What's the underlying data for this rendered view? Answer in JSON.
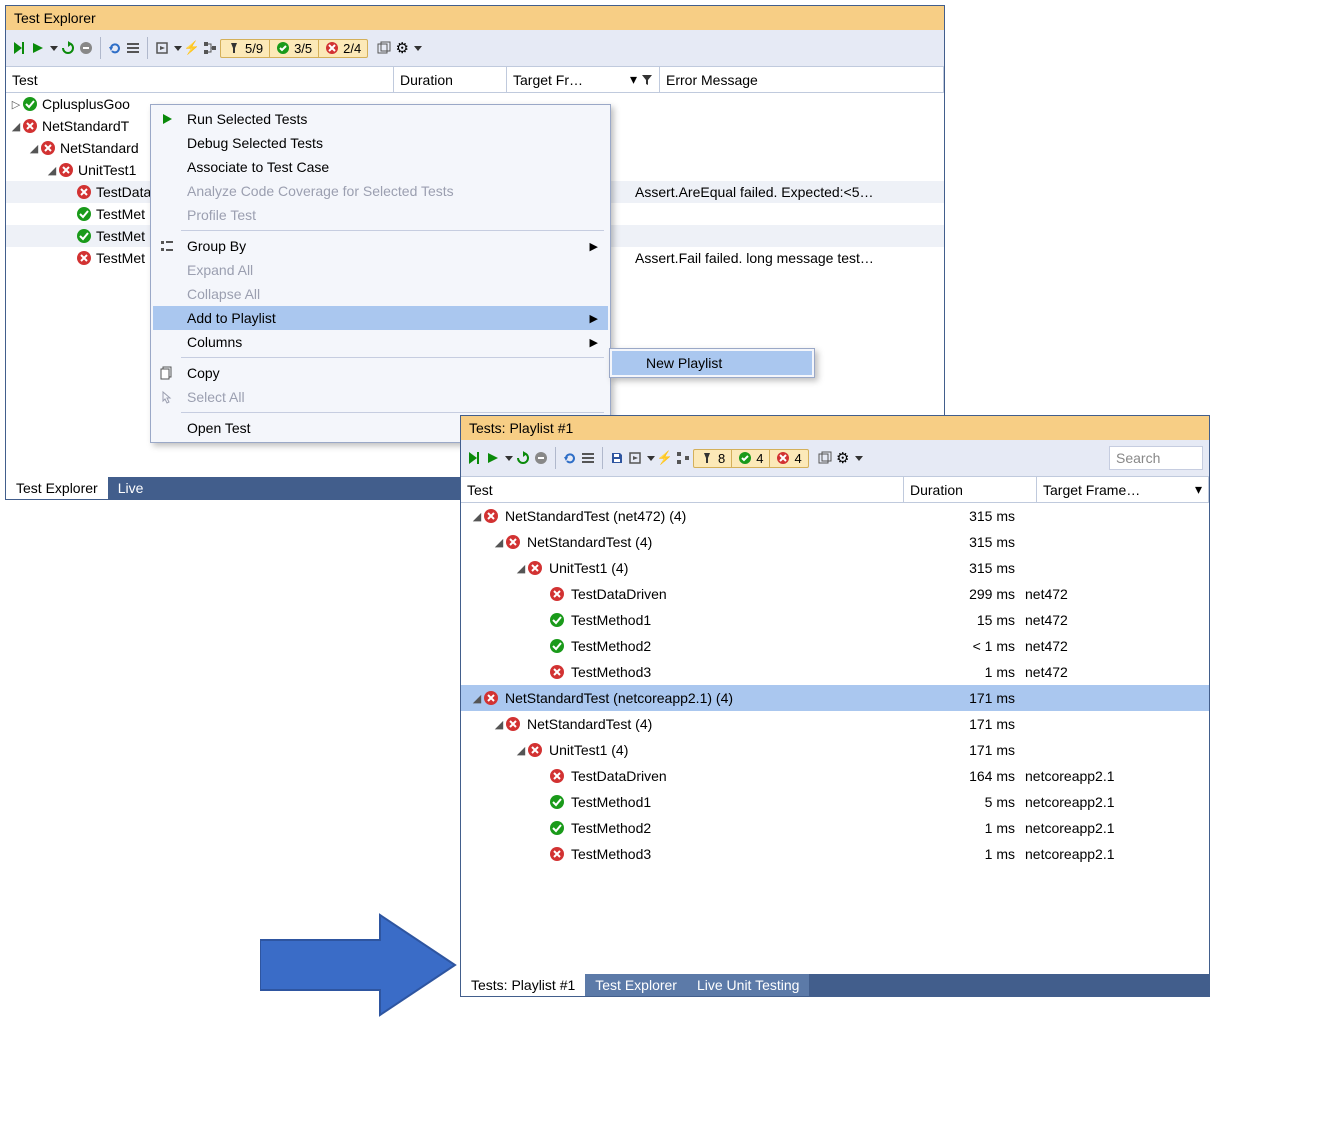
{
  "panel1": {
    "title": "Test Explorer",
    "counts": {
      "total": "5/9",
      "pass": "3/5",
      "fail": "2/4"
    },
    "columns": [
      "Test",
      "Duration",
      "Target Fr…",
      "Error Message"
    ],
    "tree": [
      {
        "indent": 0,
        "exp": "▷",
        "icon": "pass",
        "label": "CplusplusGoo"
      },
      {
        "indent": 0,
        "exp": "◢",
        "icon": "fail",
        "label": "NetStandardT"
      },
      {
        "indent": 1,
        "exp": "◢",
        "icon": "fail",
        "label": "NetStandard"
      },
      {
        "indent": 2,
        "exp": "◢",
        "icon": "fail",
        "label": "UnitTest1"
      },
      {
        "indent": 3,
        "exp": "",
        "icon": "fail",
        "label": "TestData",
        "err": "Assert.AreEqual failed. Expected:<5…",
        "alt": true
      },
      {
        "indent": 3,
        "exp": "",
        "icon": "pass",
        "label": "TestMet"
      },
      {
        "indent": 3,
        "exp": "",
        "icon": "pass",
        "label": "TestMet",
        "alt": true
      },
      {
        "indent": 3,
        "exp": "",
        "icon": "fail",
        "label": "TestMet",
        "err": "Assert.Fail failed. long message test…"
      }
    ],
    "tabs": [
      "Test Explorer",
      "Live"
    ]
  },
  "context_menu": {
    "items": [
      {
        "label": "Run Selected Tests",
        "enabled": true,
        "icon": "play"
      },
      {
        "label": "Debug Selected Tests",
        "enabled": true
      },
      {
        "label": "Associate to Test Case",
        "enabled": true
      },
      {
        "label": "Analyze Code Coverage for Selected Tests",
        "enabled": false
      },
      {
        "label": "Profile Test",
        "enabled": false
      },
      {
        "sep": true
      },
      {
        "label": "Group By",
        "enabled": true,
        "icon": "group",
        "arrow": true
      },
      {
        "label": "Expand All",
        "enabled": false
      },
      {
        "label": "Collapse All",
        "enabled": false
      },
      {
        "label": "Add to Playlist",
        "enabled": true,
        "arrow": true,
        "hover": true
      },
      {
        "label": "Columns",
        "enabled": true,
        "arrow": true
      },
      {
        "sep": true
      },
      {
        "label": "Copy",
        "enabled": true,
        "icon": "copy"
      },
      {
        "label": "Select All",
        "enabled": false,
        "icon": "pointer"
      },
      {
        "sep": true
      },
      {
        "label": "Open Test",
        "enabled": true
      }
    ],
    "submenu": {
      "label": "New Playlist"
    }
  },
  "panel2": {
    "title": "Tests: Playlist #1",
    "counts": {
      "total": "8",
      "pass": "4",
      "fail": "4"
    },
    "search_placeholder": "Search",
    "columns": [
      "Test",
      "Duration",
      "Target Frame…"
    ],
    "tree": [
      {
        "indent": 0,
        "exp": "◢",
        "icon": "fail",
        "label": "NetStandardTest (net472)  (4)",
        "dur": "315 ms"
      },
      {
        "indent": 1,
        "exp": "◢",
        "icon": "fail",
        "label": "NetStandardTest  (4)",
        "dur": "315 ms"
      },
      {
        "indent": 2,
        "exp": "◢",
        "icon": "fail",
        "label": "UnitTest1  (4)",
        "dur": "315 ms"
      },
      {
        "indent": 3,
        "exp": "",
        "icon": "fail",
        "label": "TestDataDriven",
        "dur": "299 ms",
        "tgt": "net472"
      },
      {
        "indent": 3,
        "exp": "",
        "icon": "pass",
        "label": "TestMethod1",
        "dur": "15 ms",
        "tgt": "net472"
      },
      {
        "indent": 3,
        "exp": "",
        "icon": "pass",
        "label": "TestMethod2",
        "dur": "< 1 ms",
        "tgt": "net472"
      },
      {
        "indent": 3,
        "exp": "",
        "icon": "fail",
        "label": "TestMethod3",
        "dur": "1 ms",
        "tgt": "net472"
      },
      {
        "indent": 0,
        "exp": "◢",
        "icon": "fail",
        "label": "NetStandardTest (netcoreapp2.1)  (4)",
        "dur": "171 ms",
        "sel": true
      },
      {
        "indent": 1,
        "exp": "◢",
        "icon": "fail",
        "label": "NetStandardTest  (4)",
        "dur": "171 ms"
      },
      {
        "indent": 2,
        "exp": "◢",
        "icon": "fail",
        "label": "UnitTest1  (4)",
        "dur": "171 ms"
      },
      {
        "indent": 3,
        "exp": "",
        "icon": "fail",
        "label": "TestDataDriven",
        "dur": "164 ms",
        "tgt": "netcoreapp2.1"
      },
      {
        "indent": 3,
        "exp": "",
        "icon": "pass",
        "label": "TestMethod1",
        "dur": "5 ms",
        "tgt": "netcoreapp2.1"
      },
      {
        "indent": 3,
        "exp": "",
        "icon": "pass",
        "label": "TestMethod2",
        "dur": "1 ms",
        "tgt": "netcoreapp2.1"
      },
      {
        "indent": 3,
        "exp": "",
        "icon": "fail",
        "label": "TestMethod3",
        "dur": "1 ms",
        "tgt": "netcoreapp2.1"
      }
    ],
    "tabs": [
      "Tests: Playlist #1",
      "Test Explorer",
      "Live Unit Testing"
    ]
  }
}
